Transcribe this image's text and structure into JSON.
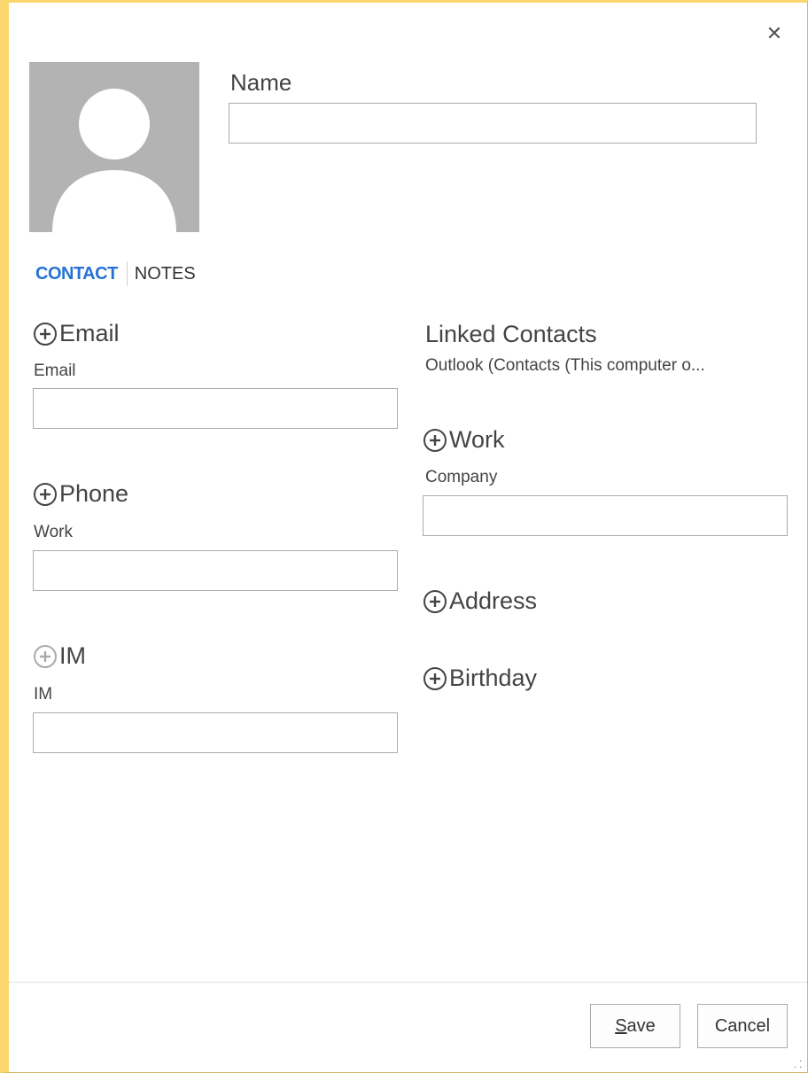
{
  "window": {
    "close_icon": "close-icon",
    "accent_color": "#fcd770"
  },
  "header": {
    "name_label": "Name",
    "name_value": ""
  },
  "tabs": [
    {
      "label": "CONTACT",
      "active": true
    },
    {
      "label": "NOTES",
      "active": false
    }
  ],
  "left_column": {
    "email": {
      "section_label": "Email",
      "field_label": "Email",
      "value": ""
    },
    "phone": {
      "section_label": "Phone",
      "field_label": "Work",
      "value": ""
    },
    "im": {
      "section_label": "IM",
      "field_label": "IM",
      "value": ""
    }
  },
  "right_column": {
    "linked_title": "Linked Contacts",
    "linked_value": "Outlook (Contacts (This computer o...",
    "work": {
      "section_label": "Work",
      "field_label": "Company",
      "value": ""
    },
    "address": {
      "section_label": "Address"
    },
    "birthday": {
      "section_label": "Birthday"
    }
  },
  "footer": {
    "save_label": "Save",
    "save_access_key": "S",
    "cancel_label": "Cancel"
  },
  "colors": {
    "tab_active": "#2672d7",
    "avatar_bg": "#b3b3b3"
  }
}
